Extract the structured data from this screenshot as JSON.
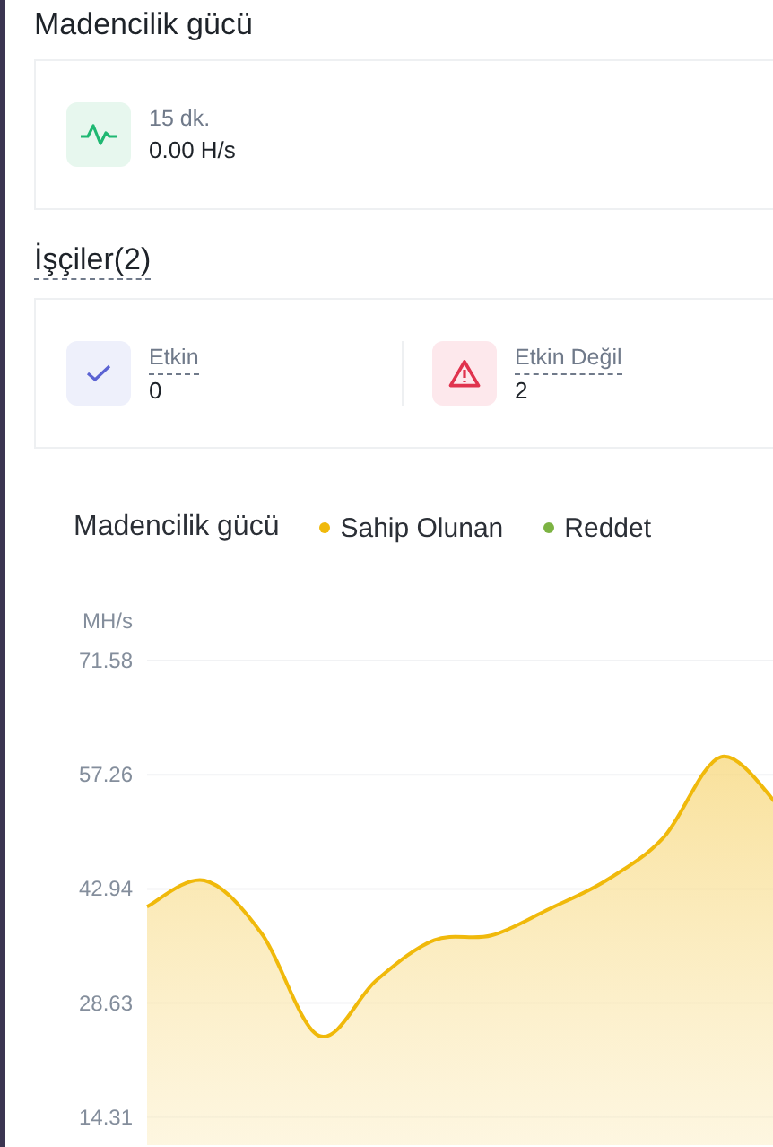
{
  "section_title": "Madencilik gücü",
  "hashrate_card": {
    "period": "15 dk.",
    "value": "0.00 H/s"
  },
  "workers": {
    "title": "İşçiler(2)",
    "items": [
      {
        "kind": "active",
        "label": "Etkin",
        "count": "0"
      },
      {
        "kind": "inactive",
        "label": "Etkin Değil",
        "count": "2"
      }
    ]
  },
  "chart": {
    "title": "Madencilik gücü",
    "legend_extra": [
      {
        "label": "Reddet",
        "color": "#7cb342"
      }
    ],
    "chart_data": {
      "type": "area",
      "grid": true,
      "ylabel": "MH/s",
      "ylim": [
        0,
        71.58
      ],
      "yticks": [
        14.31,
        28.63,
        42.94,
        57.26,
        71.58
      ],
      "series": [
        {
          "name": "Sahip Olunan",
          "color": "#f0b90b",
          "values": [
            40.7,
            44.0,
            37.3,
            24.5,
            31.5,
            36.5,
            37.1,
            40.4,
            44.0,
            49.4,
            59.5,
            53.4
          ]
        }
      ]
    }
  }
}
